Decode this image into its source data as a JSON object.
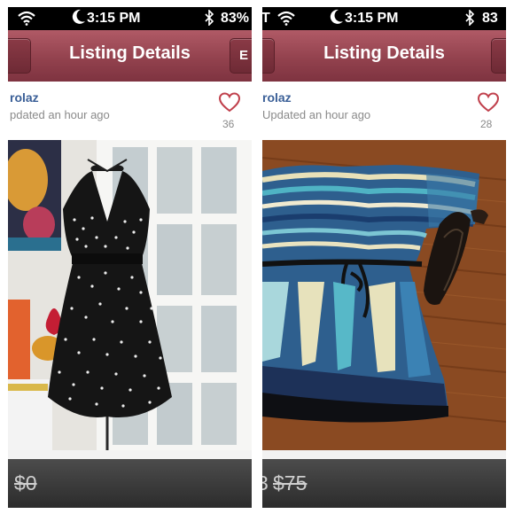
{
  "status_bar": {
    "time": "3:15 PM",
    "left_battery": "83%",
    "right_battery": "83",
    "right_carrier": "T"
  },
  "navbar": {
    "title": "Listing Details",
    "edit_label": "E"
  },
  "listings": [
    {
      "seller": "rolaz",
      "updated": "pdated an hour ago",
      "likes": "36",
      "price": "$0"
    },
    {
      "seller": "rolaz",
      "updated": "Updated an hour ago",
      "likes": "28",
      "price": "$75",
      "price_prefix": "3"
    }
  ],
  "colors": {
    "navbar": "#93424e",
    "heart": "#c0404c",
    "seller_link": "#3a5f97"
  },
  "icons": [
    "wifi-icon",
    "moon-icon",
    "bluetooth-icon",
    "heart-icon"
  ]
}
